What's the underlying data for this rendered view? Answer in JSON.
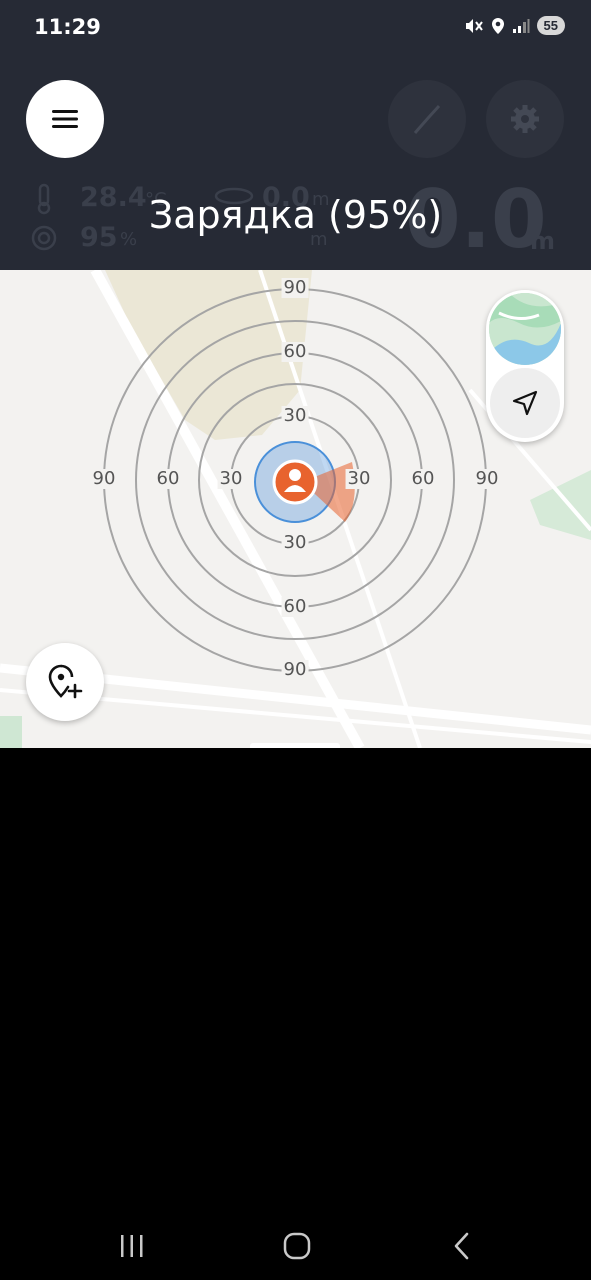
{
  "status_bar": {
    "time": "11:29",
    "battery": "55"
  },
  "overlay": {
    "charging_text": "Зарядка (95%)"
  },
  "ghost_stats": {
    "temp_value": "28.4",
    "temp_unit": "°C",
    "humidity_value": "95",
    "humidity_unit": "%",
    "distance_value": "0.0",
    "distance_unit": "m",
    "depth_unit": "m",
    "big_value": "0.0",
    "big_unit": "m"
  },
  "radar": {
    "labels": {
      "top_90": "90",
      "top_60": "60",
      "top_30": "30",
      "bottom_30": "30",
      "bottom_60": "60",
      "bottom_90": "90",
      "left_90": "90",
      "left_60": "60",
      "left_30": "30",
      "right_30": "30",
      "right_60": "60",
      "right_90": "90"
    }
  },
  "colors": {
    "header_bg": "#262a35",
    "accent_orange": "#e8632e",
    "accuracy_blue": "#4a90d9"
  },
  "icons": {
    "menu": "hamburger-icon",
    "rod": "fishing-rod-icon",
    "settings": "gear-icon",
    "map_layer": "map-thumbnail",
    "navigate": "navigation-arrow-icon",
    "add_point": "add-location-icon",
    "user": "user-location-icon"
  }
}
